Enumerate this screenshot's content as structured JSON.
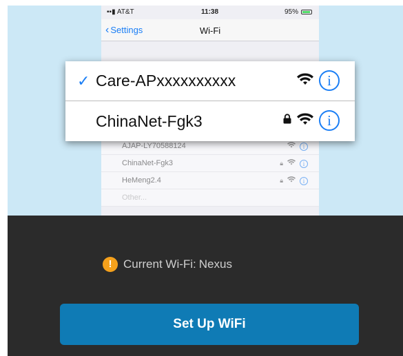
{
  "status_bar": {
    "carrier": "AT&T",
    "time": "11:38",
    "battery": "95%"
  },
  "nav": {
    "back_label": "Settings",
    "title": "Wi-Fi"
  },
  "popup": {
    "rows": [
      {
        "name": "Care-APxxxxxxxxxx",
        "selected": true,
        "locked": false
      },
      {
        "name": "ChinaNet-Fgk3",
        "selected": false,
        "locked": true
      }
    ]
  },
  "phone_list": [
    {
      "name": "AJAP-LY70588124"
    },
    {
      "name": "ChinaNet-Fgk3"
    },
    {
      "name": "HeMeng2.4"
    },
    {
      "name": "Other..."
    }
  ],
  "current_wifi": {
    "label": "Current Wi-Fi:",
    "value": "Nexus"
  },
  "setup_button": {
    "label": "Set Up WiFi"
  },
  "colors": {
    "accent_blue": "#1a7ef5",
    "button_blue": "#0f7bb5",
    "warning_orange": "#f5a11c",
    "panel_dark": "#2b2b2b"
  }
}
